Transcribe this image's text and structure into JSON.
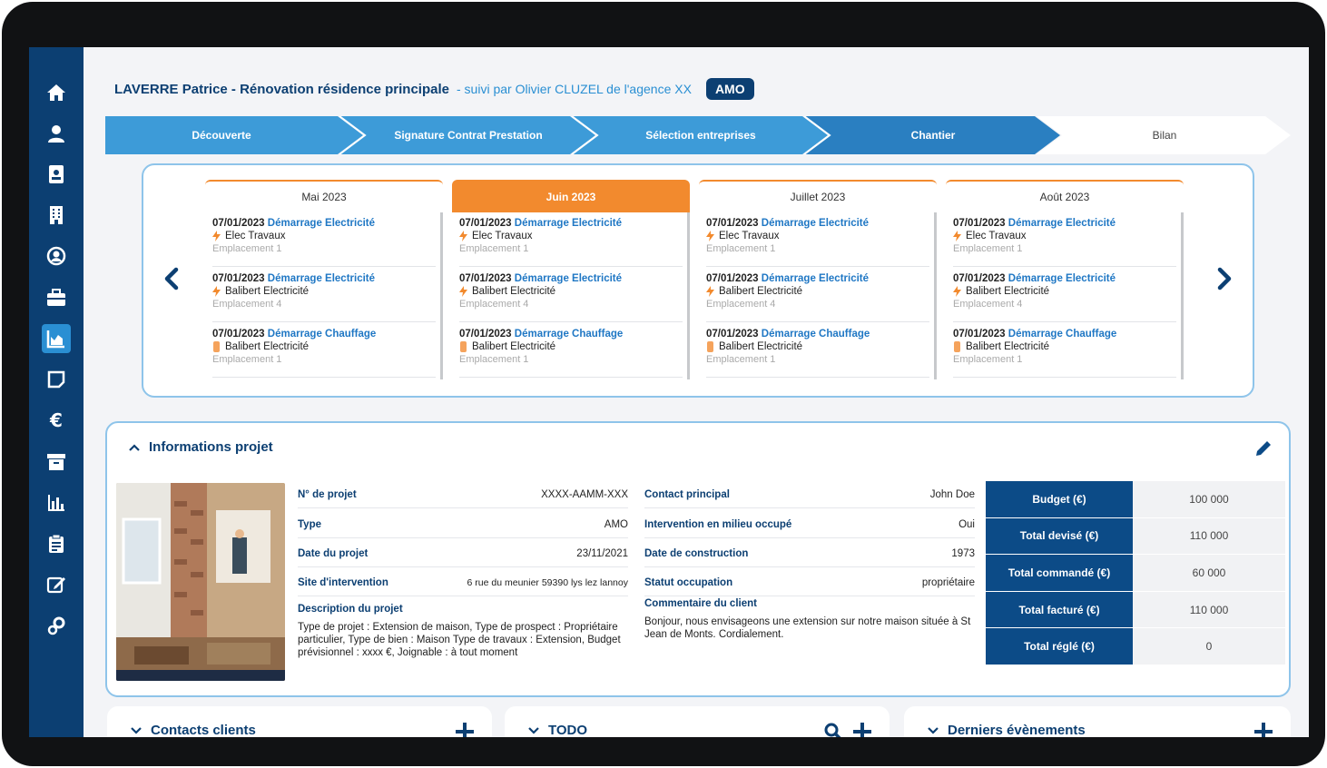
{
  "header": {
    "title": "LAVERRE Patrice - Rénovation résidence principale",
    "subtitle": "- suivi par Olivier CLUZEL de l'agence XX",
    "badge": "AMO"
  },
  "steps": [
    "Découverte",
    "Signature Contrat Prestation",
    "Sélection entreprises",
    "Chantier",
    "Bilan"
  ],
  "months": [
    {
      "label": "Mai 2023",
      "active": false
    },
    {
      "label": "Juin 2023",
      "active": true
    },
    {
      "label": "Juillet 2023",
      "active": false
    },
    {
      "label": "Août 2023",
      "active": false
    }
  ],
  "events": [
    {
      "date": "07/01/2023",
      "name": "Démarrage Electricité",
      "company": "Elec Travaux",
      "location": "Emplacement 1"
    },
    {
      "date": "07/01/2023",
      "name": "Démarrage Electricité",
      "company": "Balibert Electricité",
      "location": "Emplacement 4"
    },
    {
      "date": "07/01/2023",
      "name": "Démarrage Chauffage",
      "company": "Balibert Electricité",
      "location": "Emplacement 1"
    }
  ],
  "info": {
    "section_title": "Informations projet",
    "fields_left": [
      {
        "label": "N° de projet",
        "value": "XXXX-AAMM-XXX"
      },
      {
        "label": "Type",
        "value": "AMO"
      },
      {
        "label": "Date du projet",
        "value": "23/11/2021"
      },
      {
        "label": "Site d'intervention",
        "value": "6 rue du meunier 59390 lys lez lannoy"
      }
    ],
    "fields_right": [
      {
        "label": "Contact principal",
        "value": "John Doe"
      },
      {
        "label": "Intervention en milieu occupé",
        "value": "Oui"
      },
      {
        "label": "Date de construction",
        "value": "1973"
      },
      {
        "label": "Statut occupation",
        "value": "propriétaire"
      }
    ],
    "description_label": "Description du projet",
    "description_text": "Type de projet : Extension de maison, Type de prospect : Propriétaire particulier, Type de bien : Maison Type de travaux : Extension, Budget prévisionnel : xxxx €, Joignable : à tout moment",
    "comment_label": "Commentaire du client",
    "comment_text": "Bonjour, nous envisageons une extension sur notre maison située à St Jean de Monts. Cordialement."
  },
  "budget": [
    {
      "label": "Budget (€)",
      "value": "100 000"
    },
    {
      "label": "Total devisé (€)",
      "value": "110 000"
    },
    {
      "label": "Total commandé (€)",
      "value": "60 000"
    },
    {
      "label": "Total facturé (€)",
      "value": "110 000"
    },
    {
      "label": "Total réglé (€)",
      "value": "0"
    }
  ],
  "bottom_panels": [
    "Contacts clients",
    "TODO",
    "Derniers évènements"
  ],
  "colors": {
    "primary": "#0c3f72",
    "accent": "#2a8fd3",
    "orange": "#f28a2e",
    "step_done": "#3d9bd8",
    "step_active": "#2a7fc1"
  }
}
